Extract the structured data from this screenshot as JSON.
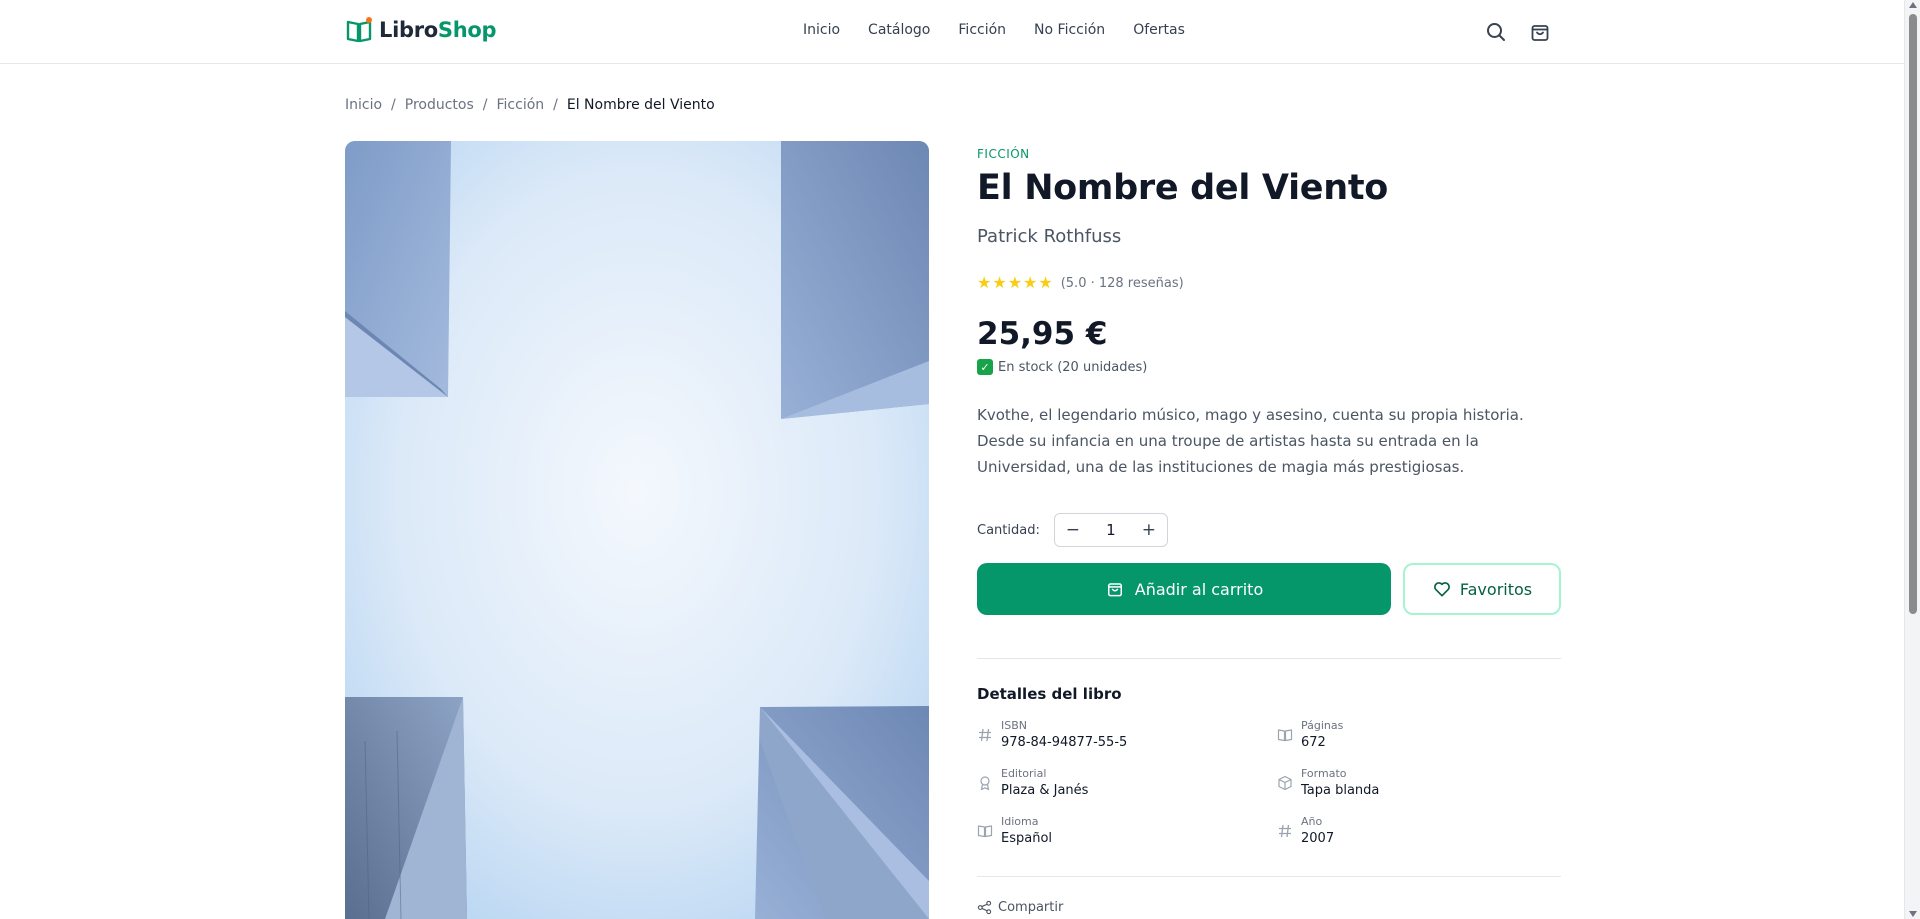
{
  "header": {
    "logo_part1": "Libro",
    "logo_part2": "Shop",
    "nav": [
      "Inicio",
      "Catálogo",
      "Ficción",
      "No Ficción",
      "Ofertas"
    ],
    "search_icon": "search-icon",
    "cart_icon": "shopping-bag-icon"
  },
  "breadcrumb": {
    "items": [
      "Inicio",
      "Productos",
      "Ficción"
    ],
    "separator": "/",
    "current": "El Nombre del Viento"
  },
  "product": {
    "category": "FICCIÓN",
    "title": "El Nombre del Viento",
    "author": "Patrick Rothfuss",
    "rating": 5,
    "rating_text": "(5.0 · 128 reseñas)",
    "price": "25,95 €",
    "stock_text": "En stock (20 unidades)",
    "description": "Kvothe, el legendario músico, mago y asesino, cuenta su propia historia. Desde su infancia en una troupe de artistas hasta su entrada en la Universidad, una de las instituciones de magia más prestigiosas.",
    "quantity_label": "Cantidad:",
    "quantity": "1",
    "decrement": "−",
    "increment": "+",
    "add_to_cart": "Añadir al carrito",
    "favorites": "Favoritos"
  },
  "details": {
    "title": "Detalles del libro",
    "isbn_label": "ISBN",
    "isbn": "978-84-94877-55-5",
    "pages_label": "Páginas",
    "pages": "672",
    "publisher_label": "Editorial",
    "publisher": "Plaza & Janés",
    "format_label": "Formato",
    "format": "Tapa blanda",
    "language_label": "Idioma",
    "language": "Español",
    "year_label": "Año",
    "year": "2007"
  },
  "share": "Compartir",
  "colors": {
    "accent": "#059669",
    "star": "#facc15",
    "text": "#111827"
  }
}
